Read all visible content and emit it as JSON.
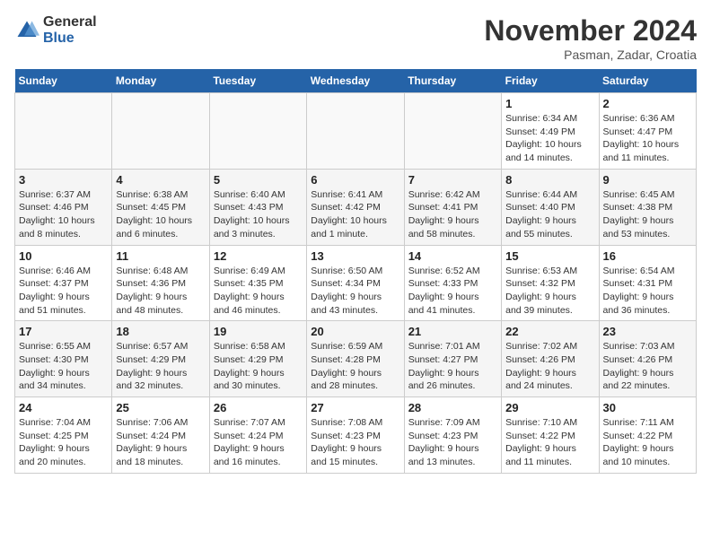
{
  "header": {
    "logo_general": "General",
    "logo_blue": "Blue",
    "title": "November 2024",
    "subtitle": "Pasman, Zadar, Croatia"
  },
  "weekdays": [
    "Sunday",
    "Monday",
    "Tuesday",
    "Wednesday",
    "Thursday",
    "Friday",
    "Saturday"
  ],
  "weeks": [
    [
      {
        "day": "",
        "info": ""
      },
      {
        "day": "",
        "info": ""
      },
      {
        "day": "",
        "info": ""
      },
      {
        "day": "",
        "info": ""
      },
      {
        "day": "",
        "info": ""
      },
      {
        "day": "1",
        "info": "Sunrise: 6:34 AM\nSunset: 4:49 PM\nDaylight: 10 hours\nand 14 minutes."
      },
      {
        "day": "2",
        "info": "Sunrise: 6:36 AM\nSunset: 4:47 PM\nDaylight: 10 hours\nand 11 minutes."
      }
    ],
    [
      {
        "day": "3",
        "info": "Sunrise: 6:37 AM\nSunset: 4:46 PM\nDaylight: 10 hours\nand 8 minutes."
      },
      {
        "day": "4",
        "info": "Sunrise: 6:38 AM\nSunset: 4:45 PM\nDaylight: 10 hours\nand 6 minutes."
      },
      {
        "day": "5",
        "info": "Sunrise: 6:40 AM\nSunset: 4:43 PM\nDaylight: 10 hours\nand 3 minutes."
      },
      {
        "day": "6",
        "info": "Sunrise: 6:41 AM\nSunset: 4:42 PM\nDaylight: 10 hours\nand 1 minute."
      },
      {
        "day": "7",
        "info": "Sunrise: 6:42 AM\nSunset: 4:41 PM\nDaylight: 9 hours\nand 58 minutes."
      },
      {
        "day": "8",
        "info": "Sunrise: 6:44 AM\nSunset: 4:40 PM\nDaylight: 9 hours\nand 55 minutes."
      },
      {
        "day": "9",
        "info": "Sunrise: 6:45 AM\nSunset: 4:38 PM\nDaylight: 9 hours\nand 53 minutes."
      }
    ],
    [
      {
        "day": "10",
        "info": "Sunrise: 6:46 AM\nSunset: 4:37 PM\nDaylight: 9 hours\nand 51 minutes."
      },
      {
        "day": "11",
        "info": "Sunrise: 6:48 AM\nSunset: 4:36 PM\nDaylight: 9 hours\nand 48 minutes."
      },
      {
        "day": "12",
        "info": "Sunrise: 6:49 AM\nSunset: 4:35 PM\nDaylight: 9 hours\nand 46 minutes."
      },
      {
        "day": "13",
        "info": "Sunrise: 6:50 AM\nSunset: 4:34 PM\nDaylight: 9 hours\nand 43 minutes."
      },
      {
        "day": "14",
        "info": "Sunrise: 6:52 AM\nSunset: 4:33 PM\nDaylight: 9 hours\nand 41 minutes."
      },
      {
        "day": "15",
        "info": "Sunrise: 6:53 AM\nSunset: 4:32 PM\nDaylight: 9 hours\nand 39 minutes."
      },
      {
        "day": "16",
        "info": "Sunrise: 6:54 AM\nSunset: 4:31 PM\nDaylight: 9 hours\nand 36 minutes."
      }
    ],
    [
      {
        "day": "17",
        "info": "Sunrise: 6:55 AM\nSunset: 4:30 PM\nDaylight: 9 hours\nand 34 minutes."
      },
      {
        "day": "18",
        "info": "Sunrise: 6:57 AM\nSunset: 4:29 PM\nDaylight: 9 hours\nand 32 minutes."
      },
      {
        "day": "19",
        "info": "Sunrise: 6:58 AM\nSunset: 4:29 PM\nDaylight: 9 hours\nand 30 minutes."
      },
      {
        "day": "20",
        "info": "Sunrise: 6:59 AM\nSunset: 4:28 PM\nDaylight: 9 hours\nand 28 minutes."
      },
      {
        "day": "21",
        "info": "Sunrise: 7:01 AM\nSunset: 4:27 PM\nDaylight: 9 hours\nand 26 minutes."
      },
      {
        "day": "22",
        "info": "Sunrise: 7:02 AM\nSunset: 4:26 PM\nDaylight: 9 hours\nand 24 minutes."
      },
      {
        "day": "23",
        "info": "Sunrise: 7:03 AM\nSunset: 4:26 PM\nDaylight: 9 hours\nand 22 minutes."
      }
    ],
    [
      {
        "day": "24",
        "info": "Sunrise: 7:04 AM\nSunset: 4:25 PM\nDaylight: 9 hours\nand 20 minutes."
      },
      {
        "day": "25",
        "info": "Sunrise: 7:06 AM\nSunset: 4:24 PM\nDaylight: 9 hours\nand 18 minutes."
      },
      {
        "day": "26",
        "info": "Sunrise: 7:07 AM\nSunset: 4:24 PM\nDaylight: 9 hours\nand 16 minutes."
      },
      {
        "day": "27",
        "info": "Sunrise: 7:08 AM\nSunset: 4:23 PM\nDaylight: 9 hours\nand 15 minutes."
      },
      {
        "day": "28",
        "info": "Sunrise: 7:09 AM\nSunset: 4:23 PM\nDaylight: 9 hours\nand 13 minutes."
      },
      {
        "day": "29",
        "info": "Sunrise: 7:10 AM\nSunset: 4:22 PM\nDaylight: 9 hours\nand 11 minutes."
      },
      {
        "day": "30",
        "info": "Sunrise: 7:11 AM\nSunset: 4:22 PM\nDaylight: 9 hours\nand 10 minutes."
      }
    ]
  ]
}
